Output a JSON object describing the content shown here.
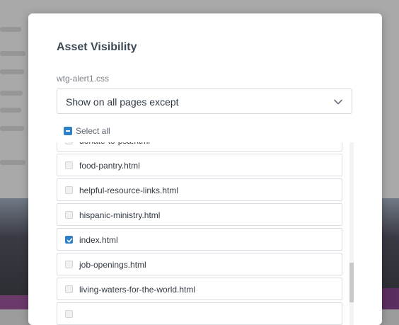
{
  "dialog": {
    "title": "Asset Visibility",
    "file_label": "wtg-alert1.css",
    "visibility_select": {
      "value": "Show on all pages except"
    },
    "select_all": {
      "label": "Select all",
      "state": "indeterminate"
    },
    "pages": [
      {
        "name": "donate-to-psa.html",
        "checked": false
      },
      {
        "name": "food-pantry.html",
        "checked": false
      },
      {
        "name": "helpful-resource-links.html",
        "checked": false
      },
      {
        "name": "hispanic-ministry.html",
        "checked": false
      },
      {
        "name": "index.html",
        "checked": true
      },
      {
        "name": "job-openings.html",
        "checked": false
      },
      {
        "name": "living-waters-for-the-world.html",
        "checked": false
      },
      {
        "name": "",
        "checked": false
      }
    ]
  },
  "colors": {
    "accent": "#2f80c7",
    "title": "#3d4a56",
    "border": "#d9dde1"
  },
  "icons": {
    "select_chevron": "chevron-down-icon",
    "checkbox_check": "check-icon"
  }
}
